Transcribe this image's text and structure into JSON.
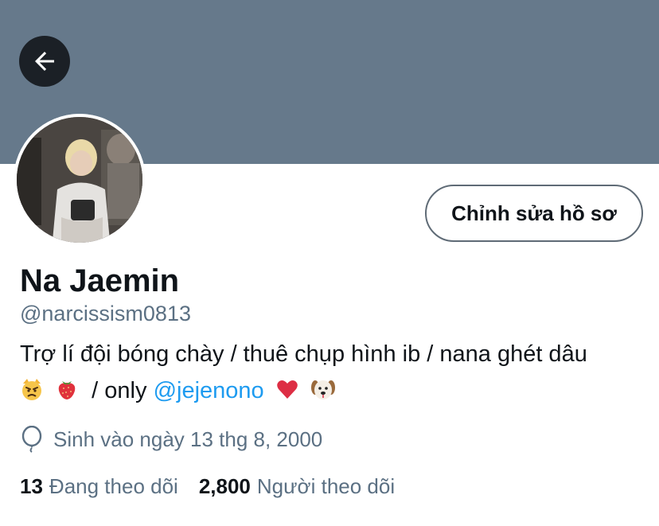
{
  "header": {
    "banner_color": "#66798b",
    "back_icon": "arrow-left-icon"
  },
  "profile": {
    "edit_button_label": "Chỉnh sửa hồ sơ",
    "display_name": "Na Jaemin",
    "handle": "@narcissism0813",
    "bio_line1": "Trợ lí đội bóng chày / thuê chụp hình ib / nana ghét dâu",
    "bio_line2_text": " / only ",
    "bio_mention": "@jejenono",
    "bio_emojis": [
      "angry-cat-emoji",
      "strawberry-emoji",
      "red-heart-emoji",
      "dog-face-emoji"
    ],
    "birthday": "Sinh vào ngày 13 thg 8, 2000",
    "following_count": "13",
    "following_label": "Đang theo dõi",
    "followers_count": "2,800",
    "followers_label": "Người theo dõi",
    "mention_color": "#1d9bf0"
  }
}
